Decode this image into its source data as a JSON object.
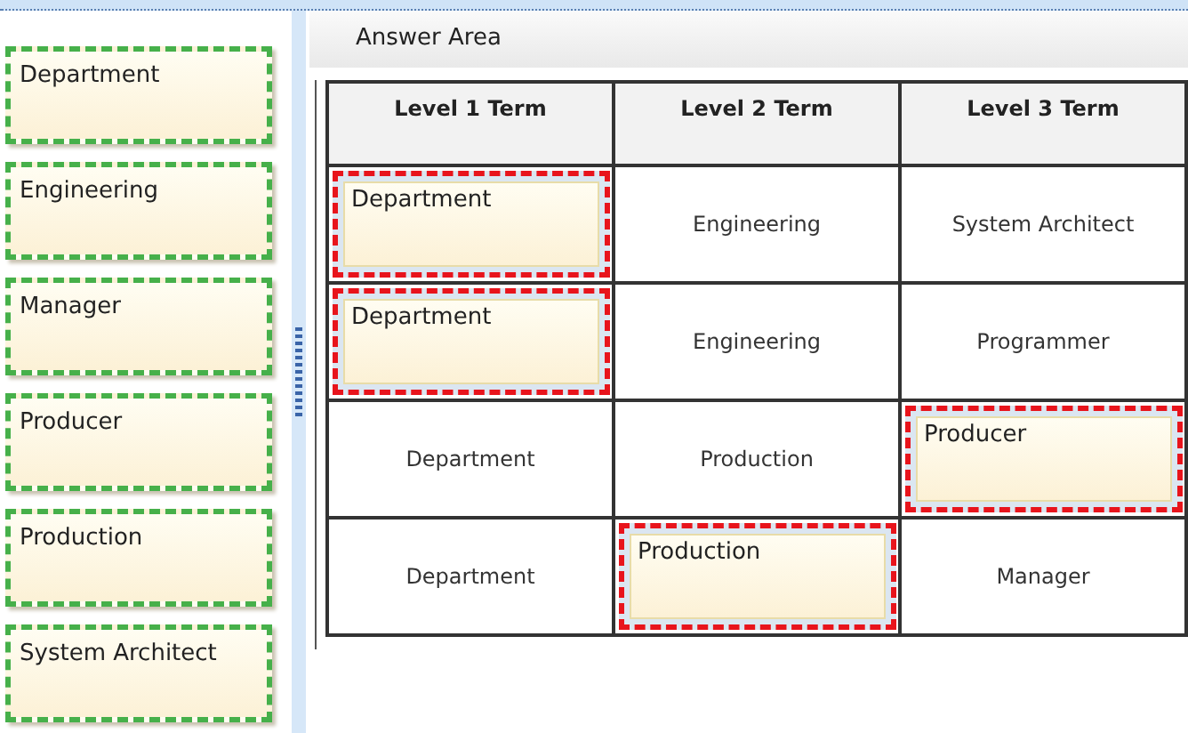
{
  "answer_choices": [
    "Department",
    "Engineering",
    "Manager",
    "Producer",
    "Production",
    "System Architect"
  ],
  "answer_area": {
    "title": "Answer Area",
    "columns": [
      "Level 1 Term",
      "Level 2 Term",
      "Level 3 Term"
    ],
    "rows": [
      [
        {
          "kind": "tile",
          "text": "Department"
        },
        {
          "kind": "text",
          "text": "Engineering"
        },
        {
          "kind": "text",
          "text": "System Architect"
        }
      ],
      [
        {
          "kind": "tile",
          "text": "Department"
        },
        {
          "kind": "text",
          "text": "Engineering"
        },
        {
          "kind": "text",
          "text": "Programmer"
        }
      ],
      [
        {
          "kind": "text",
          "text": "Department"
        },
        {
          "kind": "text",
          "text": "Production"
        },
        {
          "kind": "tile",
          "text": "Producer"
        }
      ],
      [
        {
          "kind": "text",
          "text": "Department"
        },
        {
          "kind": "tile",
          "text": "Production"
        },
        {
          "kind": "text",
          "text": "Manager"
        }
      ]
    ]
  }
}
